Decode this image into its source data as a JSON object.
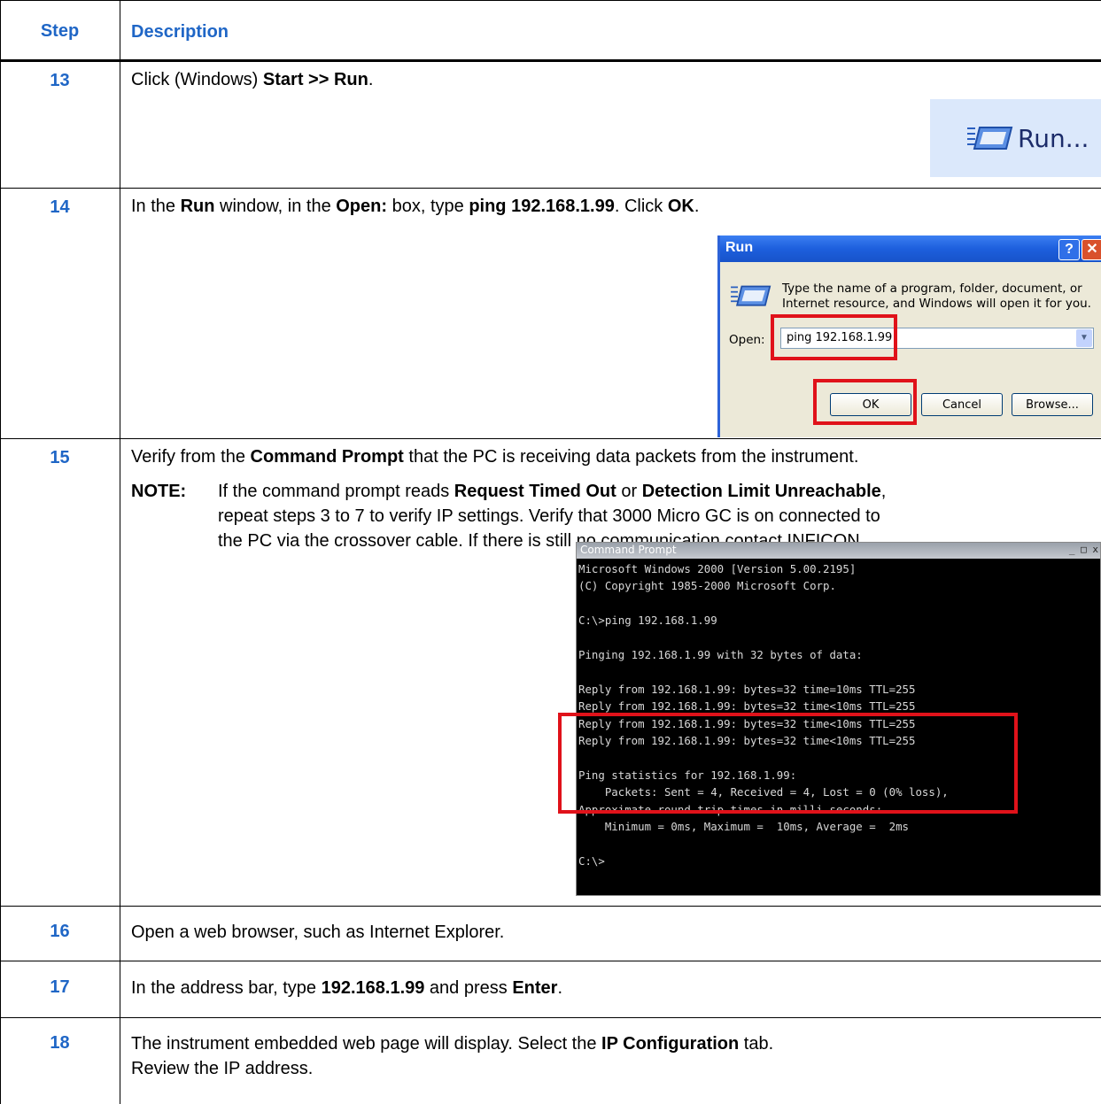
{
  "header": {
    "step": "Step",
    "description": "Description"
  },
  "rows": [
    {
      "step": "13",
      "line1": [
        {
          "t": "Click (Windows) "
        },
        {
          "b": "Start >> Run"
        },
        {
          "t": "."
        }
      ]
    },
    {
      "step": "14",
      "line1": [
        {
          "t": "In the "
        },
        {
          "b": "Run"
        },
        {
          "t": " window, in the "
        },
        {
          "b": "Open:"
        },
        {
          "t": " box, type "
        },
        {
          "b": "ping 192.168.1.99"
        },
        {
          "t": ". Click "
        },
        {
          "b": "OK"
        },
        {
          "t": "."
        }
      ]
    },
    {
      "step": "15",
      "line1": [
        {
          "t": "Verify from the "
        },
        {
          "b": "Command Prompt"
        },
        {
          "t": " that the PC is receiving data packets from the instrument."
        }
      ],
      "note_label": "NOTE:",
      "note_line1": [
        {
          "t": "If the command prompt reads "
        },
        {
          "b": "Request Timed Out"
        },
        {
          "t": " or "
        },
        {
          "b": "Detection Limit Unreachable"
        },
        {
          "t": ","
        }
      ],
      "note_line2": "repeat steps 3 to 7 to verify IP settings. Verify that 3000 Micro GC is on connected to",
      "note_line3": "the PC via the crossover cable. If there is still no communication contact INFICON."
    },
    {
      "step": "16",
      "line1": [
        {
          "t": "Open a web browser, such as Internet Explorer."
        }
      ]
    },
    {
      "step": "17",
      "line1": [
        {
          "t": "In the address bar, type "
        },
        {
          "b": "192.168.1.99"
        },
        {
          "t": " and press "
        },
        {
          "b": "Enter"
        },
        {
          "t": "."
        }
      ]
    },
    {
      "step": "18",
      "line1": [
        {
          "t": "The instrument embedded web page will display. Select the "
        },
        {
          "b": "IP Configuration"
        },
        {
          "t": " tab."
        }
      ],
      "line2": "Review the IP address."
    }
  ],
  "run_menu": {
    "label": "Run...",
    "icon": "run-icon"
  },
  "run_dialog": {
    "title": "Run",
    "help_glyph": "?",
    "close_glyph": "✕",
    "prompt": "Type the name of a program, folder, document, or Internet resource, and Windows will open it for you.",
    "open_label": "Open:",
    "open_value": "ping 192.168.1.99",
    "ok": "OK",
    "cancel": "Cancel",
    "browse": "Browse...",
    "highlight_color": "#e0121a"
  },
  "command_prompt": {
    "title": "Command Prompt",
    "window_controls": "_ □ x",
    "lines": [
      "Microsoft Windows 2000 [Version 5.00.2195]",
      "(C) Copyright 1985-2000 Microsoft Corp.",
      "",
      "C:\\>ping 192.168.1.99",
      "",
      "Pinging 192.168.1.99 with 32 bytes of data:",
      "",
      "Reply from 192.168.1.99: bytes=32 time=10ms TTL=255",
      "Reply from 192.168.1.99: bytes=32 time<10ms TTL=255",
      "Reply from 192.168.1.99: bytes=32 time<10ms TTL=255",
      "Reply from 192.168.1.99: bytes=32 time<10ms TTL=255",
      "",
      "Ping statistics for 192.168.1.99:",
      "    Packets: Sent = 4, Received = 4, Lost = 0 (0% loss),",
      "Approximate round trip times in milli-seconds:",
      "    Minimum = 0ms, Maximum =  10ms, Average =  2ms",
      "",
      "C:\\>"
    ]
  },
  "colors": {
    "step_blue": "#1f66c6",
    "highlight": "#e0121a",
    "menu_bg": "#dbe8fb"
  }
}
